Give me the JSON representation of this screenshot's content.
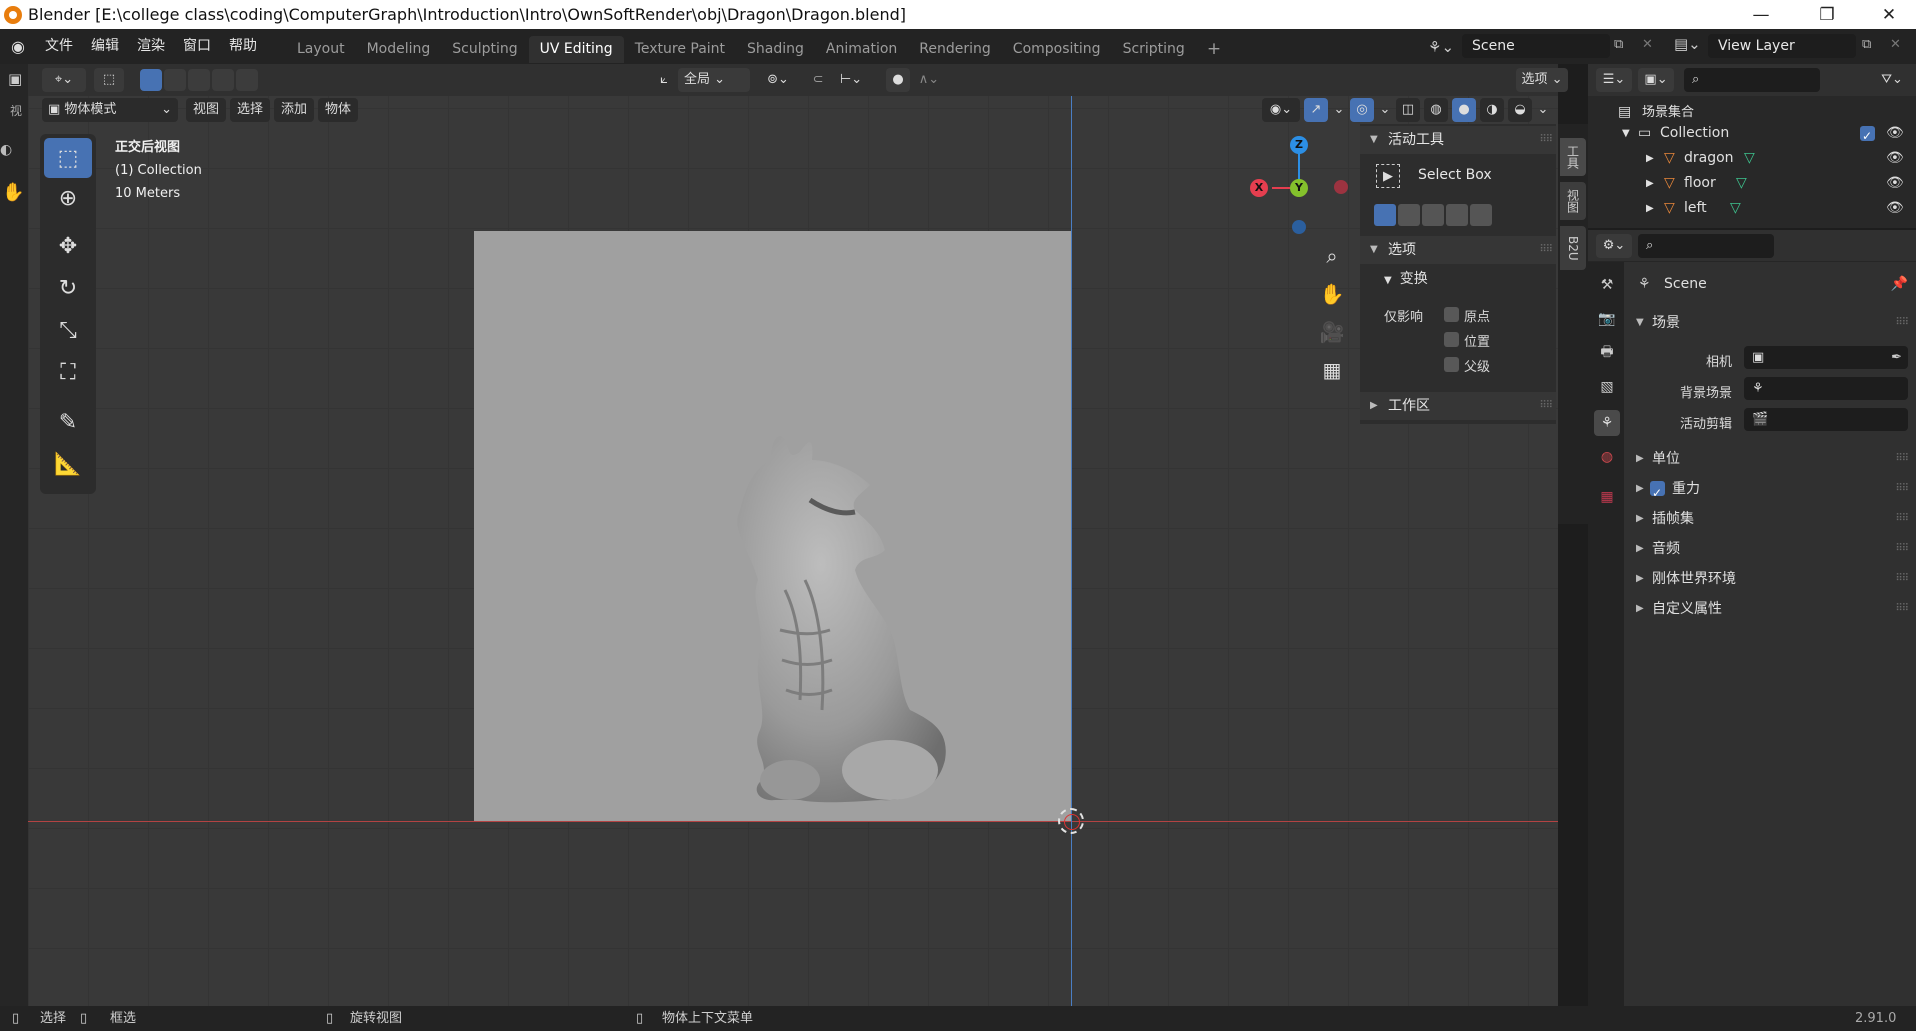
{
  "window": {
    "title": "Blender [E:\\college class\\coding\\ComputerGraph\\Introduction\\Intro\\OwnSoftRender\\obj\\Dragon\\Dragon.blend]",
    "controls": [
      "minimize-icon",
      "restore-icon",
      "close-icon"
    ]
  },
  "menu": {
    "items": [
      "文件",
      "编辑",
      "渲染",
      "窗口",
      "帮助"
    ]
  },
  "workspaces": {
    "tabs": [
      "Layout",
      "Modeling",
      "Sculpting",
      "UV Editing",
      "Texture Paint",
      "Shading",
      "Animation",
      "Rendering",
      "Compositing",
      "Scripting"
    ],
    "active": "UV Editing",
    "add": "+"
  },
  "scene": {
    "name": "Scene"
  },
  "view_layer": {
    "name": "View Layer"
  },
  "header": {
    "mode": "物体模式",
    "menus": [
      "视图",
      "选择",
      "添加",
      "物体"
    ],
    "transform_orientation": "全局",
    "options": "选项"
  },
  "viewport": {
    "view_name": "正交后视图",
    "collection": "(1) Collection",
    "scale": "10 Meters",
    "gizmo": {
      "z": "Z",
      "y": "Y",
      "x": "X"
    }
  },
  "tools": [
    "select-box-icon",
    "cursor-icon",
    "move-icon",
    "rotate-icon",
    "scale-icon",
    "transform-icon",
    "annotate-icon",
    "measure-icon"
  ],
  "npanel": {
    "active_tool_title": "活动工具",
    "tool_name": "Select Box",
    "options_title": "选项",
    "transform_title": "变换",
    "affect_only_label": "仅影响",
    "affect_only": [
      {
        "label": "原点",
        "checked": false
      },
      {
        "label": "位置",
        "checked": false
      },
      {
        "label": "父级",
        "checked": false
      }
    ],
    "workspace_title": "工作区",
    "vertical_tabs": [
      "工具",
      "视图",
      "B2U"
    ]
  },
  "outliner": {
    "root": "场景集合",
    "collection": "Collection",
    "objects": [
      "dragon",
      "floor",
      "left"
    ]
  },
  "properties": {
    "context": "Scene",
    "section": "场景",
    "camera_label": "相机",
    "background_label": "背景场景",
    "active_clip_label": "活动剪辑",
    "subsections": [
      {
        "label": "单位",
        "checkbox": false
      },
      {
        "label": "重力",
        "checkbox": true
      },
      {
        "label": "插帧集",
        "checkbox": false
      },
      {
        "label": "音频",
        "checkbox": false
      },
      {
        "label": "刚体世界环境",
        "checkbox": false
      },
      {
        "label": "自定义属性",
        "checkbox": false
      }
    ]
  },
  "status": {
    "select": "选择",
    "box_select": "框选",
    "rotate_view": "旋转视图",
    "context_menu": "物体上下文菜单",
    "version": "2.91.0"
  },
  "colors": {
    "accent": "#4772b3",
    "object_orange": "#e8873a",
    "mesh_green": "#3ec48f",
    "axis_x": "#e53e4f",
    "axis_y": "#84c12c",
    "axis_z": "#2c8fe5"
  }
}
